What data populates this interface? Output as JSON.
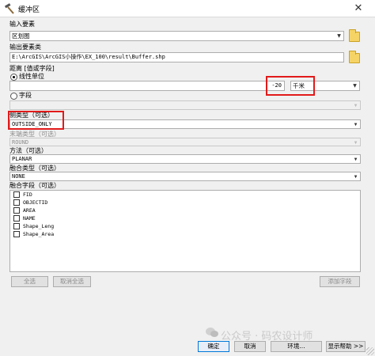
{
  "window": {
    "title": "缓冲区",
    "close_glyph": "✕"
  },
  "input_features": {
    "label": "输入要素",
    "value": "区划图"
  },
  "output_features": {
    "label": "输出要素类",
    "value": "E:\\ArcGIS\\ArcGIS小操作\\EX_100\\result\\Buffer.shp"
  },
  "distance": {
    "label": "距离 [值或字段]",
    "linear_unit_label": "线性单位",
    "value": "-20",
    "unit": "千米",
    "field_label": "字段",
    "linear_selected": true
  },
  "side_type": {
    "label": "侧类型（可选）",
    "value": "OUTSIDE_ONLY"
  },
  "end_type": {
    "label": "末端类型（可选）",
    "value": "ROUND"
  },
  "method": {
    "label": "方法（可选）",
    "value": "PLANAR"
  },
  "dissolve_type": {
    "label": "融合类型（可选）",
    "value": "NONE"
  },
  "dissolve_fields": {
    "label": "融合字段（可选）",
    "items": [
      "FID",
      "OBJECTID",
      "AREA",
      "NAME",
      "Shape_Leng",
      "Shape_Area"
    ]
  },
  "list_buttons": {
    "select_all": "全选",
    "clear_all": "取消全选",
    "add_field": "添加字段"
  },
  "footer": {
    "ok": "确定",
    "cancel": "取消",
    "env": "环境...",
    "help": "显示帮助 >>"
  },
  "watermark": "公众号 · 码农设计师",
  "colors": {
    "highlight": "#e21a1a",
    "folder": "#f6d365"
  },
  "icons": {
    "title": "hammer-icon",
    "folder": "folder-icon",
    "dropdown": "chevron-down-icon",
    "watermark": "wechat-icon"
  }
}
